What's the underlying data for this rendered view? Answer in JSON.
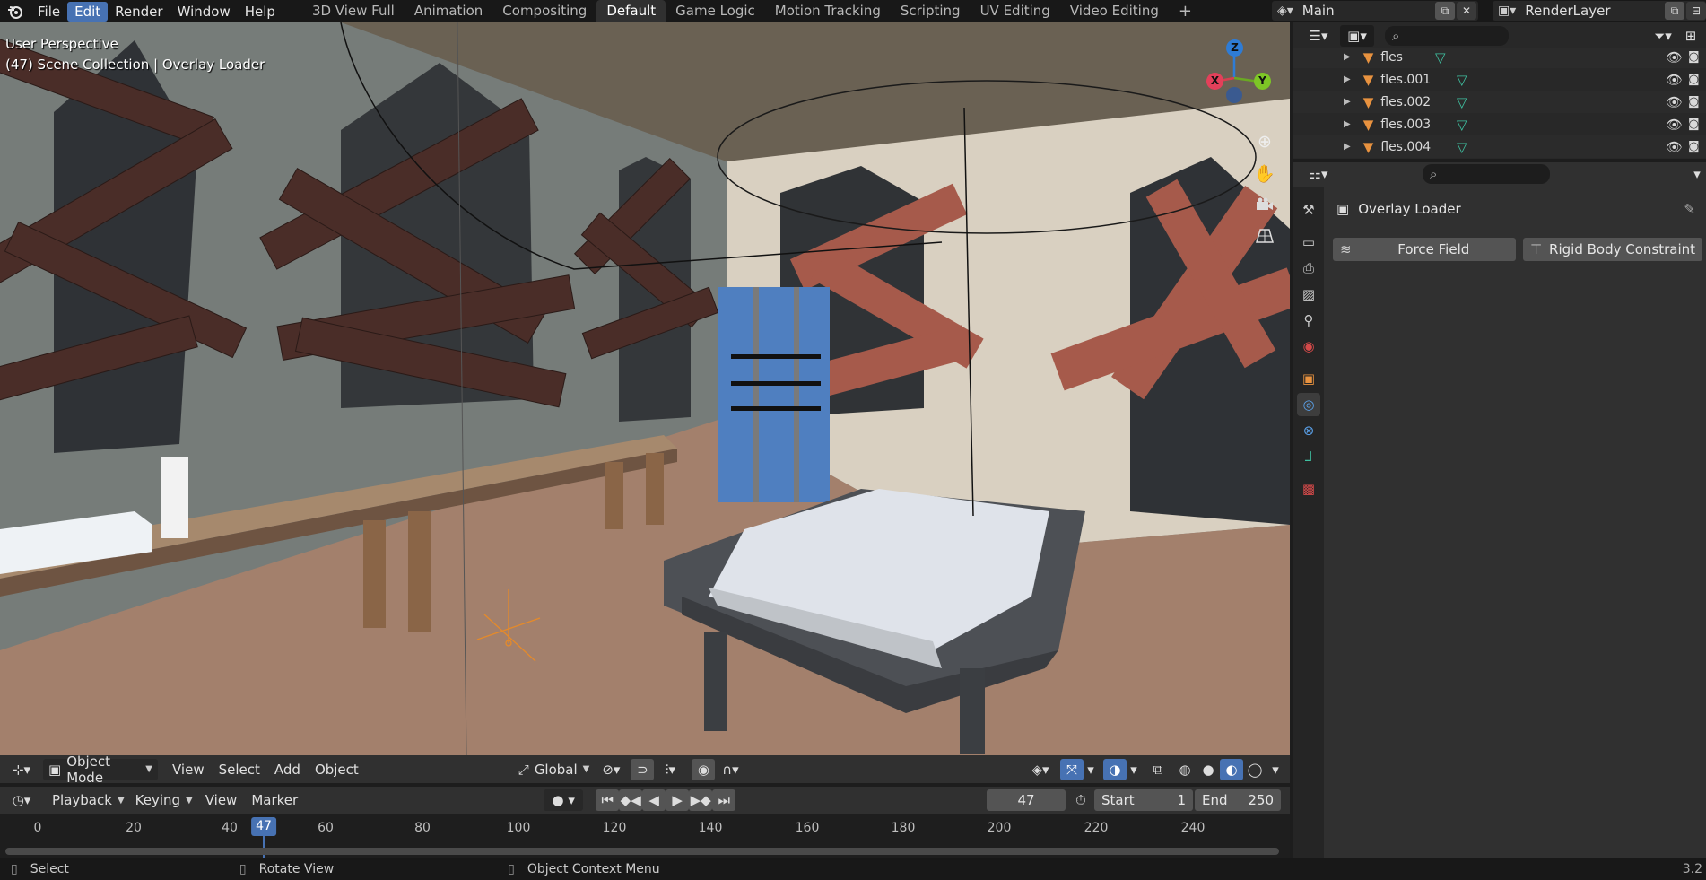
{
  "topbar": {
    "menus": [
      "File",
      "Edit",
      "Render",
      "Window",
      "Help"
    ],
    "active_menu": "Edit",
    "workspaces": [
      "3D View Full",
      "Animation",
      "Compositing",
      "Default",
      "Game Logic",
      "Motion Tracking",
      "Scripting",
      "UV Editing",
      "Video Editing"
    ],
    "active_workspace": "Default",
    "add_tab": "+",
    "scene_name": "Main",
    "view_layer": "RenderLayer"
  },
  "viewport": {
    "perspective_label": "User Perspective",
    "collection_label": "(47) Scene Collection | Overlay Loader",
    "gizmo": {
      "z": "Z",
      "x": "X",
      "y": "Y"
    }
  },
  "viewport_header": {
    "mode": "Object Mode",
    "menus": [
      "View",
      "Select",
      "Add",
      "Object"
    ],
    "orientation": "Global"
  },
  "timeline_header": {
    "menus": [
      "Playback",
      "Keying",
      "View",
      "Marker"
    ],
    "current_frame": "47",
    "start_label": "Start",
    "start_value": "1",
    "end_label": "End",
    "end_value": "250"
  },
  "timeline": {
    "ticks": [
      "0",
      "20",
      "40",
      "60",
      "80",
      "100",
      "120",
      "140",
      "160",
      "180",
      "200",
      "220",
      "240"
    ],
    "current": "47"
  },
  "outliner": {
    "items": [
      "fles",
      "fles.001",
      "fles.002",
      "fles.003",
      "fles.004"
    ]
  },
  "properties": {
    "object_name": "Overlay Loader",
    "force_field_label": "Force Field",
    "rigid_body_constraint_label": "Rigid Body Constraint"
  },
  "statusbar": {
    "select": "Select",
    "rotate_view": "Rotate View",
    "context_menu": "Object Context Menu",
    "version": "3.2"
  },
  "colors": {
    "accent": "#4772b3",
    "header_bg": "#303030",
    "panel_bg": "#282828",
    "outliner_mesh_orange": "#e8923f",
    "outliner_data_green": "#3fc0a0"
  }
}
